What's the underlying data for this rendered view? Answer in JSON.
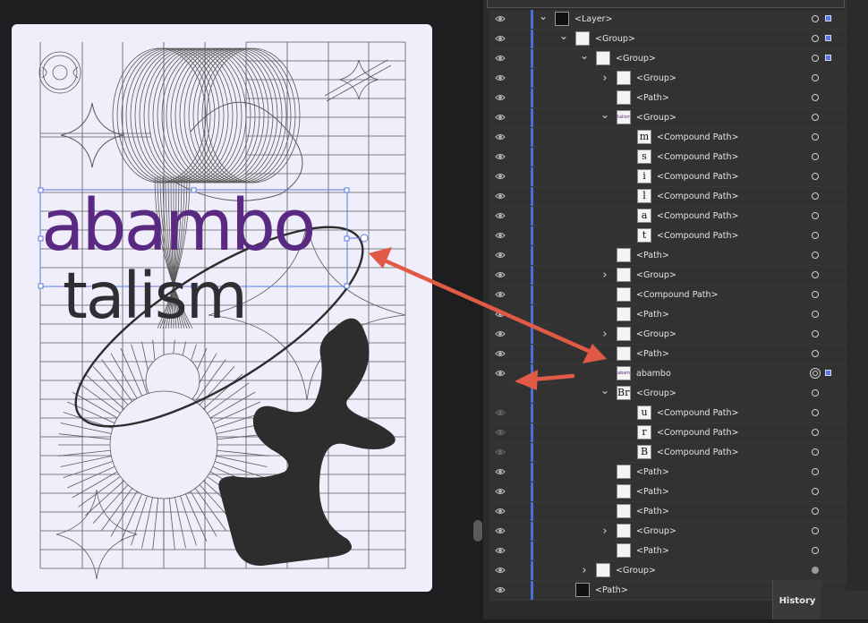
{
  "artboard": {
    "word1": "abambo",
    "word2": "talism"
  },
  "layers_panel": {
    "rows": [
      {
        "label": "<Layer>",
        "indent": 0,
        "chevron": "down",
        "thumb": "",
        "thumb_style": "dark",
        "target": "ring",
        "selected": true
      },
      {
        "label": "<Group>",
        "indent": 1,
        "chevron": "down",
        "thumb": "",
        "thumb_style": "light",
        "target": "ring",
        "selected": true
      },
      {
        "label": "<Group>",
        "indent": 2,
        "chevron": "down",
        "thumb": "",
        "thumb_style": "light",
        "target": "ring",
        "selected": true
      },
      {
        "label": "<Group>",
        "indent": 3,
        "chevron": "right",
        "thumb": "",
        "thumb_style": "light",
        "target": "ring",
        "selected": false
      },
      {
        "label": "<Path>",
        "indent": 3,
        "chevron": "",
        "thumb": "",
        "thumb_style": "light",
        "target": "ring",
        "selected": false
      },
      {
        "label": "<Group>",
        "indent": 3,
        "chevron": "down",
        "thumb": "talism",
        "thumb_style": "tiny",
        "target": "ring",
        "selected": false
      },
      {
        "label": "<Compound Path>",
        "indent": 4,
        "chevron": "",
        "thumb": "m",
        "thumb_style": "light",
        "target": "ring",
        "selected": false
      },
      {
        "label": "<Compound Path>",
        "indent": 4,
        "chevron": "",
        "thumb": "s",
        "thumb_style": "light",
        "target": "ring",
        "selected": false
      },
      {
        "label": "<Compound Path>",
        "indent": 4,
        "chevron": "",
        "thumb": "i",
        "thumb_style": "light",
        "target": "ring",
        "selected": false
      },
      {
        "label": "<Compound Path>",
        "indent": 4,
        "chevron": "",
        "thumb": "l",
        "thumb_style": "light",
        "target": "ring",
        "selected": false
      },
      {
        "label": "<Compound Path>",
        "indent": 4,
        "chevron": "",
        "thumb": "a",
        "thumb_style": "light",
        "target": "ring",
        "selected": false
      },
      {
        "label": "<Compound Path>",
        "indent": 4,
        "chevron": "",
        "thumb": "t",
        "thumb_style": "light",
        "target": "ring",
        "selected": false
      },
      {
        "label": "<Path>",
        "indent": 3,
        "chevron": "",
        "thumb": "",
        "thumb_style": "light",
        "target": "ring",
        "selected": false
      },
      {
        "label": "<Group>",
        "indent": 3,
        "chevron": "right",
        "thumb": "",
        "thumb_style": "light",
        "target": "ring",
        "selected": false
      },
      {
        "label": "<Compound Path>",
        "indent": 3,
        "chevron": "",
        "thumb": "",
        "thumb_style": "light",
        "target": "ring",
        "selected": false
      },
      {
        "label": "<Path>",
        "indent": 3,
        "chevron": "",
        "thumb": "",
        "thumb_style": "light",
        "target": "ring",
        "selected": false
      },
      {
        "label": "<Group>",
        "indent": 3,
        "chevron": "right",
        "thumb": "",
        "thumb_style": "light",
        "target": "ring",
        "selected": false
      },
      {
        "label": "<Path>",
        "indent": 3,
        "chevron": "",
        "thumb": "",
        "thumb_style": "light",
        "target": "ring",
        "selected": false
      },
      {
        "label": "abambo",
        "indent": 3,
        "chevron": "",
        "thumb": "abambo",
        "thumb_style": "tiny",
        "target": "double",
        "selected": true
      },
      {
        "label": "<Group>",
        "indent": 3,
        "chevron": "down",
        "thumb": "Bru",
        "thumb_style": "light",
        "target": "ring",
        "selected": false,
        "eye_hidden": true
      },
      {
        "label": "<Compound Path>",
        "indent": 4,
        "chevron": "",
        "thumb": "u",
        "thumb_style": "light",
        "target": "ring",
        "selected": false,
        "eye_dim": true
      },
      {
        "label": "<Compound Path>",
        "indent": 4,
        "chevron": "",
        "thumb": "r",
        "thumb_style": "light",
        "target": "ring",
        "selected": false,
        "eye_dim": true
      },
      {
        "label": "<Compound Path>",
        "indent": 4,
        "chevron": "",
        "thumb": "B",
        "thumb_style": "light",
        "target": "ring",
        "selected": false,
        "eye_dim": true
      },
      {
        "label": "<Path>",
        "indent": 3,
        "chevron": "",
        "thumb": "",
        "thumb_style": "light",
        "target": "ring",
        "selected": false
      },
      {
        "label": "<Path>",
        "indent": 3,
        "chevron": "",
        "thumb": "",
        "thumb_style": "light",
        "target": "ring",
        "selected": false
      },
      {
        "label": "<Path>",
        "indent": 3,
        "chevron": "",
        "thumb": "",
        "thumb_style": "light",
        "target": "ring",
        "selected": false
      },
      {
        "label": "<Group>",
        "indent": 3,
        "chevron": "right",
        "thumb": "",
        "thumb_style": "light",
        "target": "ring",
        "selected": false
      },
      {
        "label": "<Path>",
        "indent": 3,
        "chevron": "",
        "thumb": "",
        "thumb_style": "light",
        "target": "ring",
        "selected": false
      },
      {
        "label": "<Group>",
        "indent": 2,
        "chevron": "right",
        "thumb": "",
        "thumb_style": "light",
        "target": "filled",
        "selected": false
      },
      {
        "label": "<Path>",
        "indent": 1,
        "chevron": "",
        "thumb": "",
        "thumb_style": "dark",
        "target": "ring",
        "selected": false
      }
    ]
  },
  "history_tab": {
    "label": "History"
  },
  "colors": {
    "accent": "#5b7ae0",
    "word1": "#5a2a83",
    "arrow": "#e05a45"
  },
  "icons": [
    "eye-icon",
    "chevron-down-icon",
    "chevron-right-icon",
    "target-icon"
  ]
}
